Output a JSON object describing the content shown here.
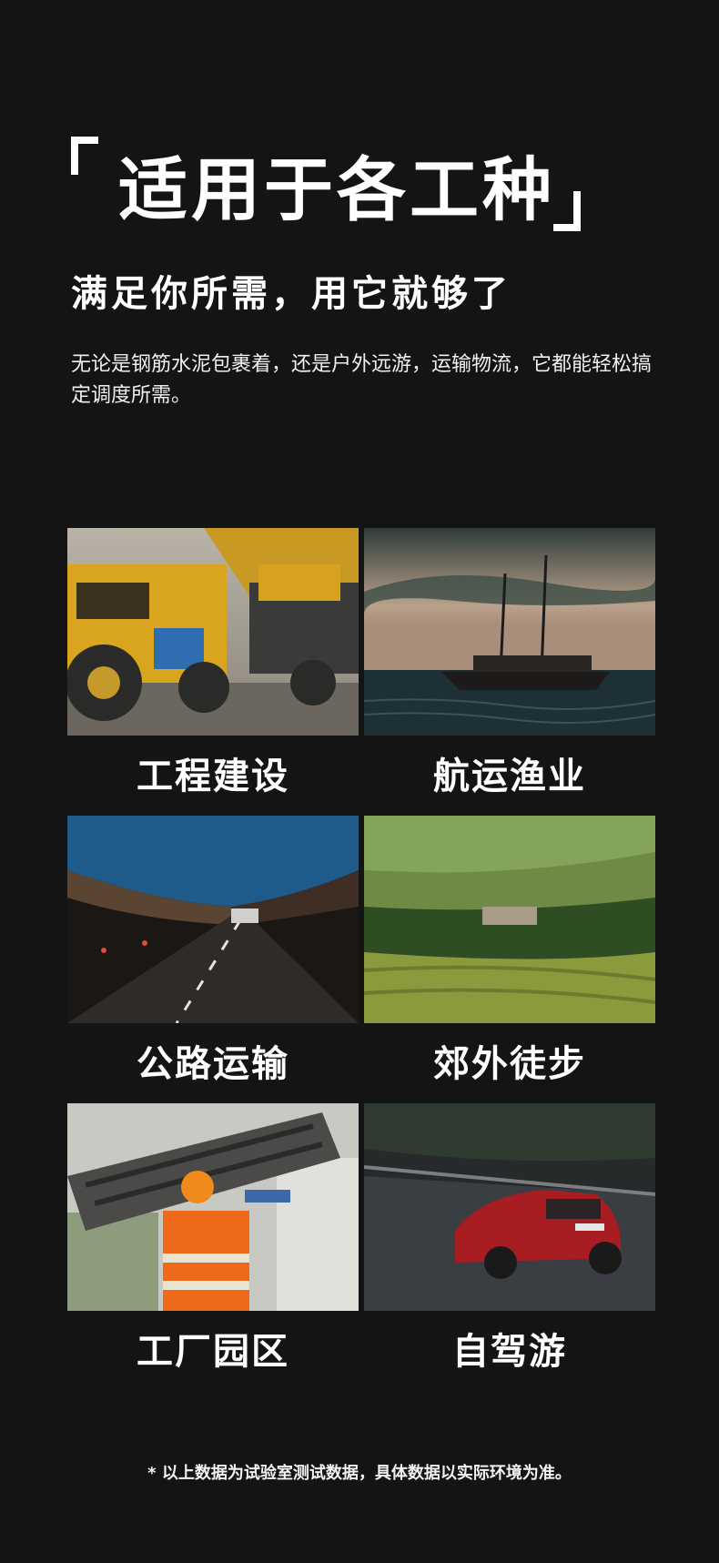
{
  "header": {
    "title": "适用于各工种",
    "subtitle": "满足你所需，用它就够了",
    "description": "无论是钢筋水泥包裹着，还是户外远游，运输物流，它都能轻松搞定调度所需。"
  },
  "scenarios": [
    {
      "label": "工程建设",
      "image": "construction-vehicles"
    },
    {
      "label": "航运渔业",
      "image": "sailing-ship"
    },
    {
      "label": "公路运输",
      "image": "road-tunnel"
    },
    {
      "label": "郊外徒步",
      "image": "terraced-fields"
    },
    {
      "label": "工厂园区",
      "image": "factory-worker"
    },
    {
      "label": "自驾游",
      "image": "red-car"
    }
  ],
  "footnote": "* 以上数据为试验室测试数据，具体数据以实际环境为准。"
}
